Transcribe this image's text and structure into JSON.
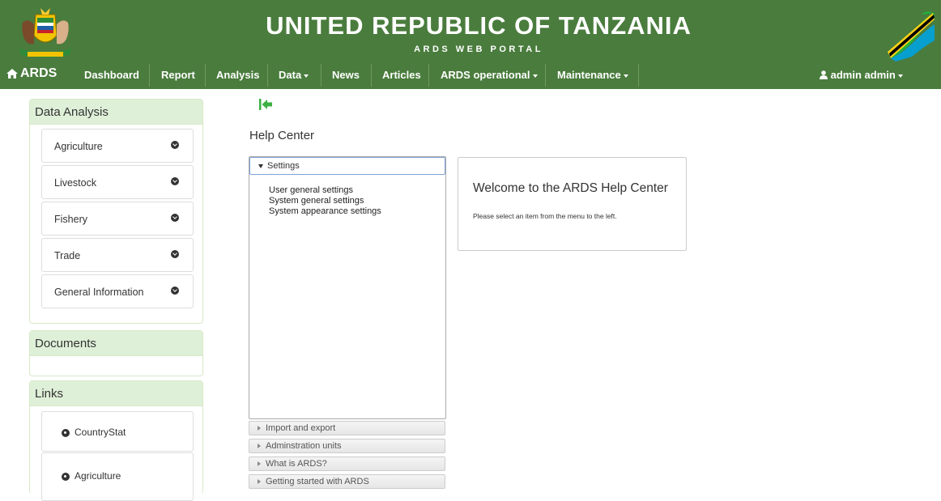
{
  "header": {
    "title": "UNITED REPUBLIC OF TANZANIA",
    "subtitle": "ARDS WEB PORTAL"
  },
  "nav": {
    "brand": "ARDS",
    "items": [
      {
        "label": "Dashboard",
        "dropdown": false
      },
      {
        "label": "Report",
        "dropdown": false
      },
      {
        "label": "Analysis",
        "dropdown": false
      },
      {
        "label": "Data",
        "dropdown": true
      },
      {
        "label": "News",
        "dropdown": false
      },
      {
        "label": "Articles",
        "dropdown": false
      },
      {
        "label": "ARDS operational",
        "dropdown": true
      },
      {
        "label": "Maintenance",
        "dropdown": true
      }
    ],
    "user": "admin admin"
  },
  "sidebar": {
    "data_analysis": {
      "title": "Data Analysis",
      "items": [
        "Agriculture",
        "Livestock",
        "Fishery",
        "Trade",
        "General Information"
      ]
    },
    "documents": {
      "title": "Documents"
    },
    "links": {
      "title": "Links",
      "items": [
        "CountryStat",
        "Agriculture"
      ]
    }
  },
  "main": {
    "title": "Help Center",
    "accordion": {
      "active": {
        "label": "Settings",
        "links": [
          "User general settings",
          "System general settings",
          "System appearance settings"
        ]
      },
      "collapsed": [
        "Import and export",
        "Adminstration units",
        "What is ARDS?",
        "Getting started with ARDS"
      ]
    },
    "welcome": {
      "title": "Welcome to the ARDS Help Center",
      "text": "Please select an item from the menu to the left."
    }
  },
  "colors": {
    "header_green": "#4a7c3d",
    "panel_heading": "#dff0d8",
    "back_icon_green": "#3cb043"
  },
  "icons": {
    "brand": "home-icon",
    "user": "user-icon",
    "back": "back-arrow-icon",
    "side_expand": "chevron-circle-down-icon",
    "link": "globe-icon"
  }
}
